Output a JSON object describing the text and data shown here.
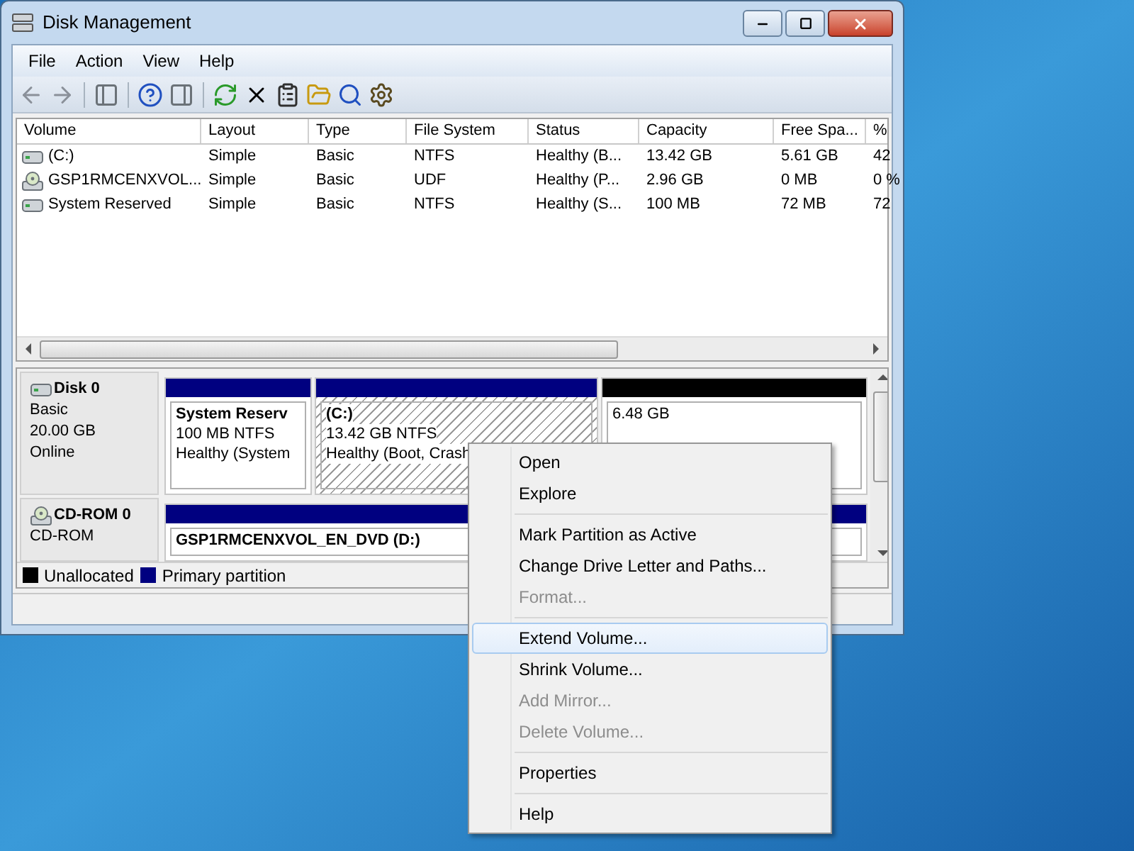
{
  "window": {
    "title": "Disk Management"
  },
  "menu_bar": [
    "File",
    "Action",
    "View",
    "Help"
  ],
  "volume_list": {
    "columns": [
      "Volume",
      "Layout",
      "Type",
      "File System",
      "Status",
      "Capacity",
      "Free Spa...",
      "%"
    ],
    "rows": [
      {
        "kind": "disk",
        "cells": [
          "(C:)",
          "Simple",
          "Basic",
          "NTFS",
          "Healthy (B...",
          "13.42 GB",
          "5.61 GB",
          "42"
        ]
      },
      {
        "kind": "cdrom",
        "cells": [
          "GSP1RMCENXVOL...",
          "Simple",
          "Basic",
          "UDF",
          "Healthy (P...",
          "2.96 GB",
          "0 MB",
          "0 %"
        ]
      },
      {
        "kind": "disk",
        "cells": [
          "System Reserved",
          "Simple",
          "Basic",
          "NTFS",
          "Healthy (S...",
          "100 MB",
          "72 MB",
          "72"
        ]
      }
    ]
  },
  "disks": [
    {
      "kind": "disk",
      "name": "Disk 0",
      "lines": [
        "Basic",
        "20.00 GB",
        "Online"
      ],
      "partitions": [
        {
          "kind": "primary",
          "selected": false,
          "title": "System Reserv",
          "lines": [
            "100 MB NTFS",
            "Healthy (System"
          ]
        },
        {
          "kind": "primary",
          "selected": true,
          "title": "(C:)",
          "lines": [
            "13.42 GB NTFS",
            "Healthy (Boot, Crash"
          ]
        },
        {
          "kind": "unallocated",
          "selected": false,
          "lines": [
            "6.48 GB"
          ]
        }
      ]
    },
    {
      "kind": "cdrom",
      "name": "CD-ROM 0",
      "lines": [
        "CD-ROM"
      ],
      "partitions": [
        {
          "kind": "primary",
          "selected": false,
          "title": "GSP1RMCENXVOL_EN_DVD (D:)"
        }
      ]
    }
  ],
  "legend": [
    {
      "label": "Unallocated",
      "color": "#000000"
    },
    {
      "label": "Primary partition",
      "color": "#000080"
    }
  ],
  "context_menu": {
    "groups": [
      [
        {
          "label": "Open",
          "disabled": false,
          "selected": false
        },
        {
          "label": "Explore",
          "disabled": false,
          "selected": false
        }
      ],
      [
        {
          "label": "Mark Partition as Active",
          "disabled": false,
          "selected": false
        },
        {
          "label": "Change Drive Letter and Paths...",
          "disabled": false,
          "selected": false
        },
        {
          "label": "Format...",
          "disabled": true,
          "selected": false
        }
      ],
      [
        {
          "label": "Extend Volume...",
          "disabled": false,
          "selected": true
        },
        {
          "label": "Shrink Volume...",
          "disabled": false,
          "selected": false
        },
        {
          "label": "Add Mirror...",
          "disabled": true,
          "selected": false
        },
        {
          "label": "Delete Volume...",
          "disabled": true,
          "selected": false
        }
      ],
      [
        {
          "label": "Properties",
          "disabled": false,
          "selected": false
        }
      ],
      [
        {
          "label": "Help",
          "disabled": false,
          "selected": false
        }
      ]
    ]
  }
}
